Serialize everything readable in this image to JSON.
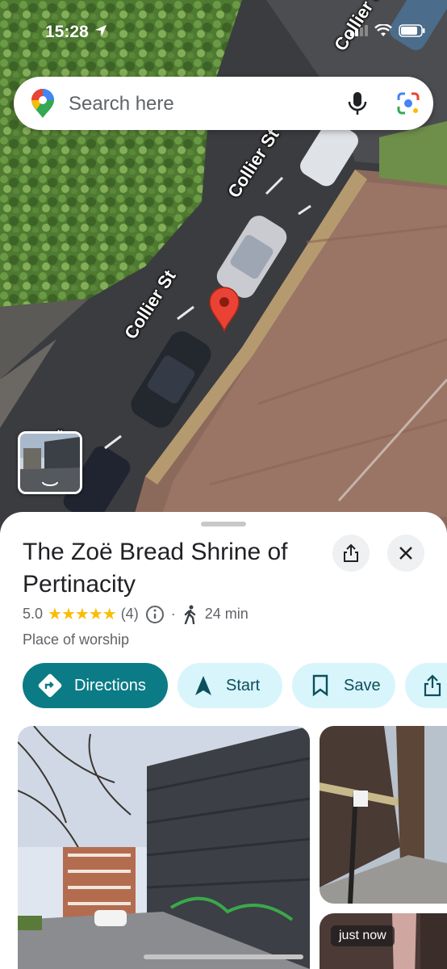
{
  "status_bar": {
    "time": "15:28"
  },
  "search": {
    "placeholder": "Search here"
  },
  "map": {
    "road_labels": [
      "Collier St",
      "Collier St",
      "Collier St",
      "St"
    ]
  },
  "place": {
    "title": "The Zoë Bread Shrine of Pertinacity",
    "rating": "5.0",
    "stars": "★★★★★",
    "review_count": "(4)",
    "separator": "·",
    "walk_time": "24 min",
    "category": "Place of worship"
  },
  "actions": {
    "directions": "Directions",
    "start": "Start",
    "save": "Save"
  },
  "photos": {
    "badge": "just now"
  },
  "colors": {
    "primary": "#0b7b86",
    "secondary_chip": "#d8f5fb",
    "star": "#fbbc04",
    "pin": "#ea4335"
  },
  "icons": [
    "location-arrow-icon",
    "signal-icon",
    "wifi-icon",
    "battery-icon",
    "maps-pin-icon",
    "mic-icon",
    "lens-icon",
    "share-icon",
    "close-icon",
    "info-icon",
    "walk-icon",
    "directions-icon",
    "navigation-icon",
    "bookmark-icon"
  ]
}
